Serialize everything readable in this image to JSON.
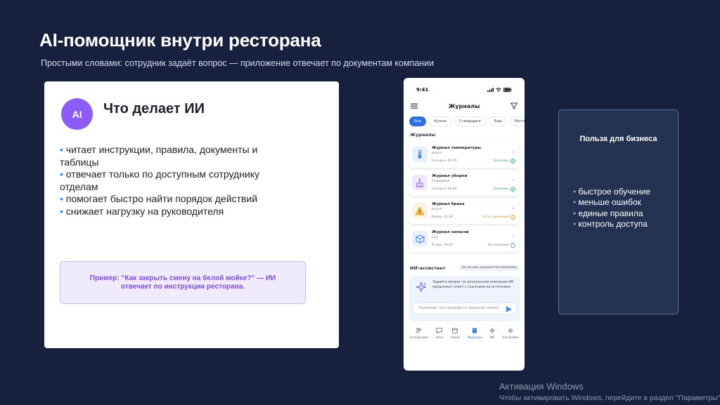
{
  "slide": {
    "title": "AI-помощник внутри ресторана",
    "subtitle": "Простыми словами: сотрудник задаёт вопрос — приложение отвечает по документам компании"
  },
  "ai_card": {
    "avatar": "AI",
    "title": "Что делает ИИ",
    "items": [
      "читает инструкции, правила, документы и таблицы",
      "отвечает только по доступным сотруднику отделам",
      "помогает быстро найти порядок действий",
      "снижает нагрузку на руководителя"
    ],
    "bullet": "•",
    "example": "Пример: “Как закрыть смену на белой мойке?” — ИИ отвечает по инструкции ресторана."
  },
  "phone": {
    "time": "9:41",
    "title": "Журналы",
    "menu_icon": "hamburger-icon",
    "filter_icon": "filter-icon",
    "chips": [
      "Все",
      "Кухня",
      "Стюардинг",
      "Бар",
      "Ресторан"
    ],
    "active_chip": 0,
    "section_journals": "Журналы",
    "journals": [
      {
        "name": "Журнал температуры",
        "dept": "Кухня",
        "time": "Сегодня, 09:15",
        "status": "Заполнен",
        "status_color": "#2f9e55",
        "icon": "thermometer-icon",
        "icon_bg": "#e8f0fd",
        "icon_color": "#3b82f6"
      },
      {
        "name": "Журнал уборки",
        "dept": "Стюардинг",
        "time": "Сегодня, 08:40",
        "status": "Заполнен",
        "status_color": "#2f9e55",
        "icon": "broom-icon",
        "icon_bg": "#f1eafc",
        "icon_color": "#8b5cf6"
      },
      {
        "name": "Журнал брака",
        "dept": "Кухня",
        "time": "Вчера, 21:30",
        "status": "Есть замечания",
        "status_color": "#e08a1e",
        "icon": "warning-icon",
        "icon_bg": "#fdf3e3",
        "icon_color": "#e0a11e"
      },
      {
        "name": "Журнал запасов",
        "dept": "Бар",
        "time": "Вчера, 18:20",
        "status": "Не заполнен",
        "status_color": "#6b7280",
        "icon": "box-icon",
        "icon_bg": "#e8f0fd",
        "icon_color": "#3b82f6"
      }
    ],
    "ai_section_title": "ИИ-ассистент",
    "ai_section_badge": "На основе документов компании",
    "ai_box_text": "Задайте вопрос по документам компании ИИ предложит ответ с ссылками на источники.",
    "ai_input_placeholder": "Например: как проводится закрытие смены?",
    "nav": [
      {
        "label": "Сотрудники",
        "icon": "people-icon"
      },
      {
        "label": "Чаты",
        "icon": "chat-icon"
      },
      {
        "label": "Смена",
        "icon": "calendar-icon"
      },
      {
        "label": "Журналы",
        "icon": "journal-icon"
      },
      {
        "label": "ИИ",
        "icon": "sparkle-icon"
      },
      {
        "label": "Настройки",
        "icon": "gear-icon"
      }
    ],
    "active_nav": 3
  },
  "benefit_card": {
    "title": "Польза для бизнеса",
    "items": [
      "быстрое обучение",
      "меньше ошибок",
      "единые правила",
      "контроль доступа"
    ],
    "bullet": "•"
  },
  "watermark": {
    "title": "Активация Windows",
    "subtitle": "Чтобы активировать Windows, перейдите в раздел \"Параметры\"."
  }
}
